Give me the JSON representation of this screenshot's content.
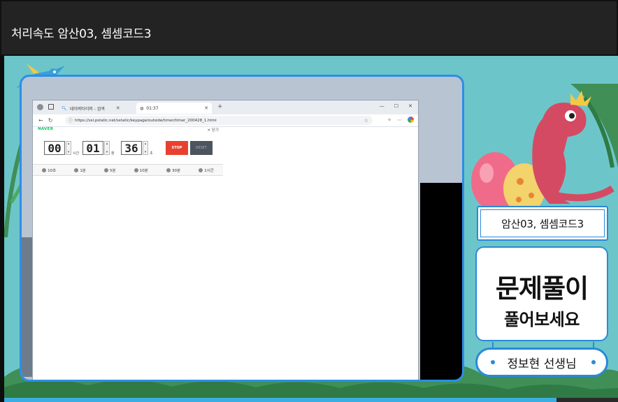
{
  "window": {
    "title": "처리속도 암산03, 셈셈코드3"
  },
  "browser": {
    "tabs": [
      {
        "label": "네이버타이머 - 검색",
        "icon": "search-icon"
      },
      {
        "label": "01:37",
        "icon": "globe-icon"
      }
    ],
    "new_tab_label": "+",
    "window_controls": [
      "—",
      "☐",
      "✕"
    ],
    "url": "https://ssl.pstatic.net/sstatic/keypage/outside/timer/timer_200428_1.html"
  },
  "timer": {
    "brand": "NAVER",
    "close_label": "✕ 닫기",
    "hours": "00",
    "hours_unit": "시간",
    "minutes": "01",
    "minutes_unit": "분",
    "seconds": "36",
    "seconds_unit": "초",
    "stop_label": "STOP",
    "reset_label": "RESET",
    "presets": [
      "10초",
      "1분",
      "5분",
      "10분",
      "30분",
      "1시간"
    ]
  },
  "overlay": {
    "lesson_title": "암산03, 셈셈코드3",
    "message_main": "문제풀이",
    "message_sub": "풀어보세요",
    "teacher": "정보현 선생님"
  },
  "colors": {
    "accent": "#2a89d8",
    "stage_bg": "#6cc6c9",
    "stop": "#e8402f"
  }
}
